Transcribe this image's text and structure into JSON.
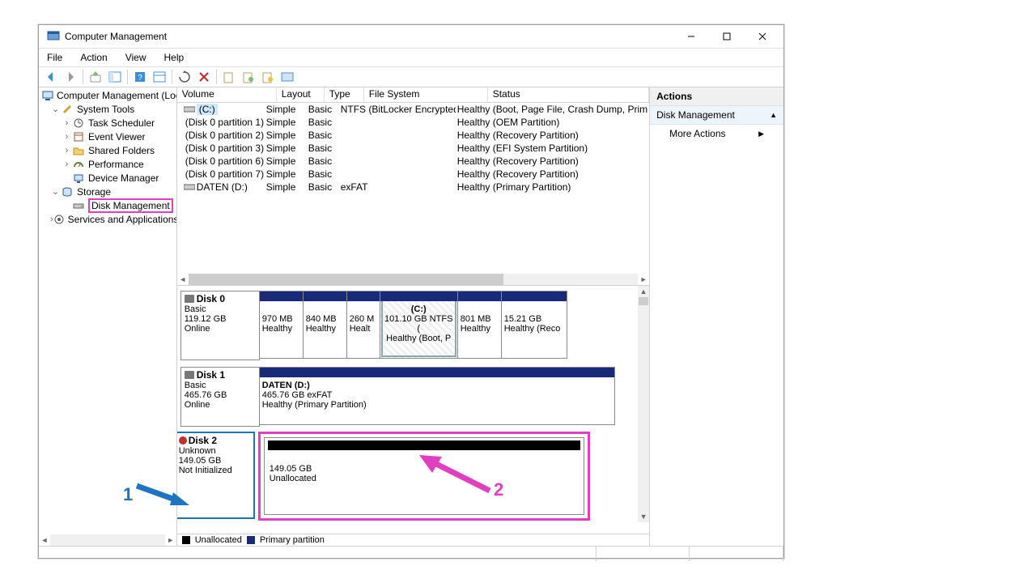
{
  "window": {
    "title": "Computer Management"
  },
  "menu": [
    "File",
    "Action",
    "View",
    "Help"
  ],
  "tree": {
    "root": "Computer Management (Local",
    "system_tools": "System Tools",
    "task_scheduler": "Task Scheduler",
    "event_viewer": "Event Viewer",
    "shared_folders": "Shared Folders",
    "performance": "Performance",
    "device_manager": "Device Manager",
    "storage": "Storage",
    "disk_management": "Disk Management",
    "services_apps": "Services and Applications"
  },
  "vol_headers": {
    "volume": "Volume",
    "layout": "Layout",
    "type": "Type",
    "fs": "File System",
    "status": "Status"
  },
  "volumes": [
    {
      "name": "(C:)",
      "layout": "Simple",
      "type": "Basic",
      "fs": "NTFS (BitLocker Encrypted)",
      "status": "Healthy (Boot, Page File, Crash Dump, Prim"
    },
    {
      "name": "(Disk 0 partition 1)",
      "layout": "Simple",
      "type": "Basic",
      "fs": "",
      "status": "Healthy (OEM Partition)"
    },
    {
      "name": "(Disk 0 partition 2)",
      "layout": "Simple",
      "type": "Basic",
      "fs": "",
      "status": "Healthy (Recovery Partition)"
    },
    {
      "name": "(Disk 0 partition 3)",
      "layout": "Simple",
      "type": "Basic",
      "fs": "",
      "status": "Healthy (EFI System Partition)"
    },
    {
      "name": "(Disk 0 partition 6)",
      "layout": "Simple",
      "type": "Basic",
      "fs": "",
      "status": "Healthy (Recovery Partition)"
    },
    {
      "name": "(Disk 0 partition 7)",
      "layout": "Simple",
      "type": "Basic",
      "fs": "",
      "status": "Healthy (Recovery Partition)"
    },
    {
      "name": "DATEN (D:)",
      "layout": "Simple",
      "type": "Basic",
      "fs": "exFAT",
      "status": "Healthy (Primary Partition)"
    }
  ],
  "disk0": {
    "title": "Disk 0",
    "type": "Basic",
    "size": "119.12 GB",
    "state": "Online",
    "parts": [
      {
        "size": "970 MB",
        "status": "Healthy"
      },
      {
        "size": "840 MB",
        "status": "Healthy"
      },
      {
        "size": "260 M",
        "status": "Healt"
      },
      {
        "label": "(C:)",
        "size": "101.10 GB NTFS (",
        "status": "Healthy (Boot, P"
      },
      {
        "size": "801 MB",
        "status": "Healthy"
      },
      {
        "size": "15.21 GB",
        "status": "Healthy (Reco"
      }
    ]
  },
  "disk1": {
    "title": "Disk 1",
    "type": "Basic",
    "size": "465.76 GB",
    "state": "Online",
    "part": {
      "label": "DATEN  (D:)",
      "size": "465.76 GB exFAT",
      "status": "Healthy (Primary Partition)"
    }
  },
  "disk2": {
    "title": "Disk 2",
    "type": "Unknown",
    "size": "149.05 GB",
    "state": "Not Initialized",
    "part": {
      "size": "149.05 GB",
      "status": "Unallocated"
    }
  },
  "legend": {
    "unallocated": "Unallocated",
    "primary": "Primary partition"
  },
  "actions": {
    "head": "Actions",
    "selected": "Disk Management",
    "more": "More Actions"
  },
  "annot": {
    "one": "1",
    "two": "2"
  }
}
